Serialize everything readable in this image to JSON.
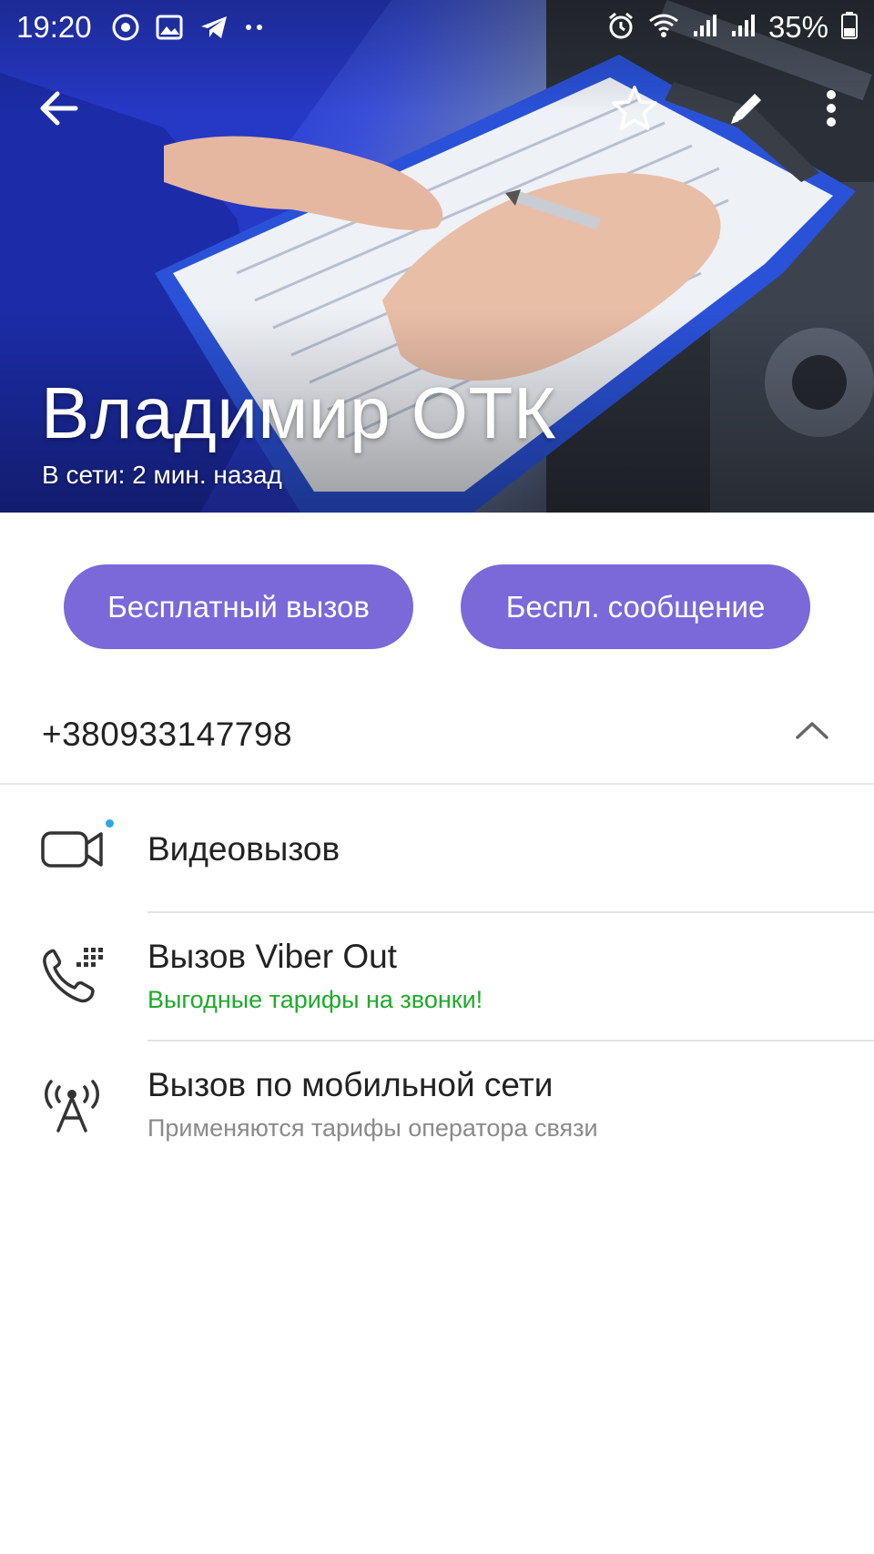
{
  "status_bar": {
    "time": "19:20",
    "battery": "35%",
    "left_icons": [
      "chrome-icon",
      "gallery-icon",
      "telegram-icon",
      "more-dots-icon"
    ],
    "right_icons": [
      "alarm-icon",
      "wifi-icon",
      "signal-icon",
      "signal-icon",
      "battery-icon"
    ]
  },
  "header": {
    "name": "Владимир ОТК",
    "status": "В сети: 2 мин. назад",
    "actions": [
      "back-arrow-icon",
      "star-icon",
      "pencil-icon",
      "more-vert-icon"
    ]
  },
  "actions": {
    "free_call": "Бесплатный вызов",
    "free_message": "Беспл. сообщение",
    "accent_color": "#7b68d9"
  },
  "phone": {
    "number": "+380933147798"
  },
  "options": [
    {
      "icon": "video-camera-icon",
      "title": "Видеовызов",
      "subtitle": ""
    },
    {
      "icon": "viber-out-phone-icon",
      "title": "Вызов Viber Out",
      "subtitle": "Выгодные тарифы на звонки!",
      "subtitle_color": "#1eaa2a"
    },
    {
      "icon": "cell-tower-icon",
      "title": "Вызов по мобильной сети",
      "subtitle": "Применяются тарифы оператора связи",
      "subtitle_color": "#8a8a8a"
    }
  ]
}
